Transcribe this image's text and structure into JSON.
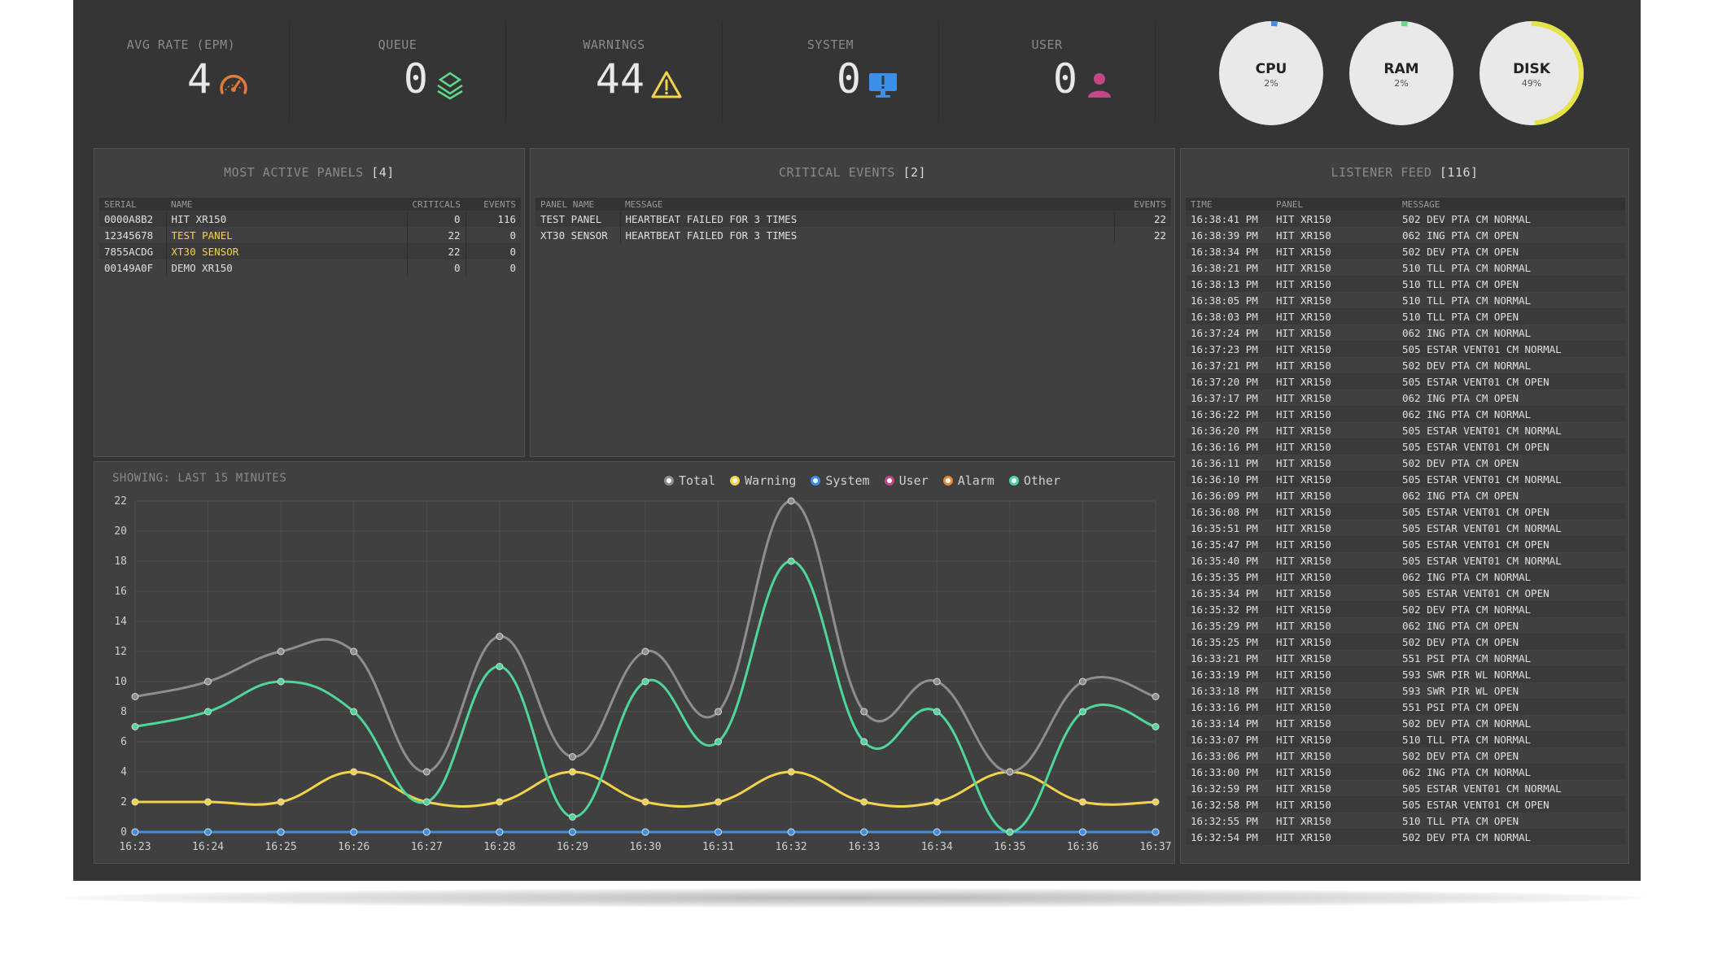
{
  "stats": [
    {
      "label": "AVG RATE (EPM)",
      "value": "4",
      "icon": "speedometer-icon",
      "color": "#e07b39"
    },
    {
      "label": "QUEUE",
      "value": "0",
      "icon": "stack-icon",
      "color": "#5fdc8a"
    },
    {
      "label": "WARNINGS",
      "value": "44",
      "icon": "warning-icon",
      "color": "#f4d24a"
    },
    {
      "label": "SYSTEM",
      "value": "0",
      "icon": "monitor-icon",
      "color": "#3b8fe8"
    },
    {
      "label": "USER",
      "value": "0",
      "icon": "user-icon",
      "color": "#c4478a"
    }
  ],
  "gauges": [
    {
      "name": "CPU",
      "value": "2%",
      "fraction": 0.02,
      "color": "#3b8fe8"
    },
    {
      "name": "RAM",
      "value": "2%",
      "fraction": 0.02,
      "color": "#5fdc8a"
    },
    {
      "name": "DISK",
      "value": "49%",
      "fraction": 0.49,
      "color": "#e5e34a"
    }
  ],
  "panels": {
    "most_active": {
      "title": "MOST ACTIVE PANELS",
      "count": "[4]",
      "columns": [
        "SERIAL",
        "NAME",
        "CRITICALS",
        "EVENTS"
      ],
      "rows": [
        {
          "serial": "0000A8B2",
          "name": "HIT XR150",
          "criticals": "0",
          "events": "116",
          "highlight": false
        },
        {
          "serial": "12345678",
          "name": "TEST PANEL",
          "criticals": "22",
          "events": "0",
          "highlight": true
        },
        {
          "serial": "7855ACDG",
          "name": "XT30 SENSOR",
          "criticals": "22",
          "events": "0",
          "highlight": true
        },
        {
          "serial": "00149A0F",
          "name": "DEMO XR150",
          "criticals": "0",
          "events": "0",
          "highlight": false
        }
      ]
    },
    "critical_events": {
      "title": "CRITICAL EVENTS",
      "count": "[2]",
      "columns": [
        "PANEL NAME",
        "MESSAGE",
        "EVENTS"
      ],
      "rows": [
        {
          "panel": "TEST PANEL",
          "message": "HEARTBEAT FAILED FOR 3 TIMES",
          "events": "22"
        },
        {
          "panel": "XT30 SENSOR",
          "message": "HEARTBEAT FAILED FOR 3 TIMES",
          "events": "22"
        }
      ]
    },
    "listener_feed": {
      "title": "LISTENER FEED",
      "count": "[116]",
      "columns": [
        "TIME",
        "PANEL",
        "MESSAGE"
      ],
      "rows": [
        {
          "time": "16:38:41 PM",
          "panel": "HIT XR150",
          "message": "502 DEV PTA CM NORMAL"
        },
        {
          "time": "16:38:39 PM",
          "panel": "HIT XR150",
          "message": "062 ING PTA CM OPEN"
        },
        {
          "time": "16:38:34 PM",
          "panel": "HIT XR150",
          "message": "502 DEV PTA CM OPEN"
        },
        {
          "time": "16:38:21 PM",
          "panel": "HIT XR150",
          "message": "510 TLL PTA CM NORMAL"
        },
        {
          "time": "16:38:13 PM",
          "panel": "HIT XR150",
          "message": "510 TLL PTA CM OPEN"
        },
        {
          "time": "16:38:05 PM",
          "panel": "HIT XR150",
          "message": "510 TLL PTA CM NORMAL"
        },
        {
          "time": "16:38:03 PM",
          "panel": "HIT XR150",
          "message": "510 TLL PTA CM OPEN"
        },
        {
          "time": "16:37:24 PM",
          "panel": "HIT XR150",
          "message": "062 ING PTA CM NORMAL"
        },
        {
          "time": "16:37:23 PM",
          "panel": "HIT XR150",
          "message": "505 ESTAR VENT01 CM NORMAL"
        },
        {
          "time": "16:37:21 PM",
          "panel": "HIT XR150",
          "message": "502 DEV PTA CM NORMAL"
        },
        {
          "time": "16:37:20 PM",
          "panel": "HIT XR150",
          "message": "505 ESTAR VENT01 CM OPEN"
        },
        {
          "time": "16:37:17 PM",
          "panel": "HIT XR150",
          "message": "062 ING PTA CM OPEN"
        },
        {
          "time": "16:36:22 PM",
          "panel": "HIT XR150",
          "message": "062 ING PTA CM NORMAL"
        },
        {
          "time": "16:36:20 PM",
          "panel": "HIT XR150",
          "message": "505 ESTAR VENT01 CM NORMAL"
        },
        {
          "time": "16:36:16 PM",
          "panel": "HIT XR150",
          "message": "505 ESTAR VENT01 CM OPEN"
        },
        {
          "time": "16:36:11 PM",
          "panel": "HIT XR150",
          "message": "502 DEV PTA CM OPEN"
        },
        {
          "time": "16:36:10 PM",
          "panel": "HIT XR150",
          "message": "505 ESTAR VENT01 CM NORMAL"
        },
        {
          "time": "16:36:09 PM",
          "panel": "HIT XR150",
          "message": "062 ING PTA CM OPEN"
        },
        {
          "time": "16:36:08 PM",
          "panel": "HIT XR150",
          "message": "505 ESTAR VENT01 CM OPEN"
        },
        {
          "time": "16:35:51 PM",
          "panel": "HIT XR150",
          "message": "505 ESTAR VENT01 CM NORMAL"
        },
        {
          "time": "16:35:47 PM",
          "panel": "HIT XR150",
          "message": "505 ESTAR VENT01 CM OPEN"
        },
        {
          "time": "16:35:40 PM",
          "panel": "HIT XR150",
          "message": "505 ESTAR VENT01 CM NORMAL"
        },
        {
          "time": "16:35:35 PM",
          "panel": "HIT XR150",
          "message": "062 ING PTA CM NORMAL"
        },
        {
          "time": "16:35:34 PM",
          "panel": "HIT XR150",
          "message": "505 ESTAR VENT01 CM OPEN"
        },
        {
          "time": "16:35:32 PM",
          "panel": "HIT XR150",
          "message": "502 DEV PTA CM NORMAL"
        },
        {
          "time": "16:35:29 PM",
          "panel": "HIT XR150",
          "message": "062 ING PTA CM OPEN"
        },
        {
          "time": "16:35:25 PM",
          "panel": "HIT XR150",
          "message": "502 DEV PTA CM OPEN"
        },
        {
          "time": "16:33:21 PM",
          "panel": "HIT XR150",
          "message": "551 PSI PTA CM NORMAL"
        },
        {
          "time": "16:33:19 PM",
          "panel": "HIT XR150",
          "message": "593 SWR PIR WL NORMAL"
        },
        {
          "time": "16:33:18 PM",
          "panel": "HIT XR150",
          "message": "593 SWR PIR WL OPEN"
        },
        {
          "time": "16:33:16 PM",
          "panel": "HIT XR150",
          "message": "551 PSI PTA CM OPEN"
        },
        {
          "time": "16:33:14 PM",
          "panel": "HIT XR150",
          "message": "502 DEV PTA CM NORMAL"
        },
        {
          "time": "16:33:07 PM",
          "panel": "HIT XR150",
          "message": "510 TLL PTA CM NORMAL"
        },
        {
          "time": "16:33:06 PM",
          "panel": "HIT XR150",
          "message": "502 DEV PTA CM OPEN"
        },
        {
          "time": "16:33:00 PM",
          "panel": "HIT XR150",
          "message": "062 ING PTA CM NORMAL"
        },
        {
          "time": "16:32:59 PM",
          "panel": "HIT XR150",
          "message": "505 ESTAR VENT01 CM NORMAL"
        },
        {
          "time": "16:32:58 PM",
          "panel": "HIT XR150",
          "message": "505 ESTAR VENT01 CM OPEN"
        },
        {
          "time": "16:32:55 PM",
          "panel": "HIT XR150",
          "message": "510 TLL PTA CM OPEN"
        },
        {
          "time": "16:32:54 PM",
          "panel": "HIT XR150",
          "message": "502 DEV PTA CM NORMAL"
        }
      ]
    }
  },
  "chart": {
    "showing": "SHOWING: LAST 15 MINUTES"
  },
  "chart_data": {
    "type": "line",
    "categories": [
      "16:23",
      "16:24",
      "16:25",
      "16:26",
      "16:27",
      "16:28",
      "16:29",
      "16:30",
      "16:31",
      "16:32",
      "16:33",
      "16:34",
      "16:35",
      "16:36",
      "16:37"
    ],
    "ylim": [
      0,
      22
    ],
    "yticks": [
      0,
      2,
      4,
      6,
      8,
      10,
      12,
      14,
      16,
      18,
      20,
      22
    ],
    "grid": true,
    "legend": "top-right",
    "series": [
      {
        "name": "Total",
        "color": "#8e8e8e",
        "values": [
          9,
          10,
          12,
          12,
          4,
          13,
          5,
          12,
          8,
          22,
          8,
          10,
          4,
          10,
          9
        ]
      },
      {
        "name": "Warning",
        "color": "#f4d24a",
        "values": [
          2,
          2,
          2,
          4,
          2,
          2,
          4,
          2,
          2,
          4,
          2,
          2,
          4,
          2,
          2
        ]
      },
      {
        "name": "System",
        "color": "#3b8fe8",
        "values": [
          0,
          0,
          0,
          0,
          0,
          0,
          0,
          0,
          0,
          0,
          0,
          0,
          0,
          0,
          0
        ]
      },
      {
        "name": "User",
        "color": "#c4478a",
        "values": [
          0,
          0,
          0,
          0,
          0,
          0,
          0,
          0,
          0,
          0,
          0,
          0,
          0,
          0,
          0
        ]
      },
      {
        "name": "Alarm",
        "color": "#e88a3a",
        "values": [
          0,
          0,
          0,
          0,
          0,
          0,
          0,
          0,
          0,
          0,
          0,
          0,
          0,
          0,
          0
        ]
      },
      {
        "name": "Other",
        "color": "#4fd69a",
        "values": [
          7,
          8,
          10,
          8,
          2,
          11,
          1,
          10,
          6,
          18,
          6,
          8,
          0,
          8,
          7
        ]
      }
    ]
  }
}
